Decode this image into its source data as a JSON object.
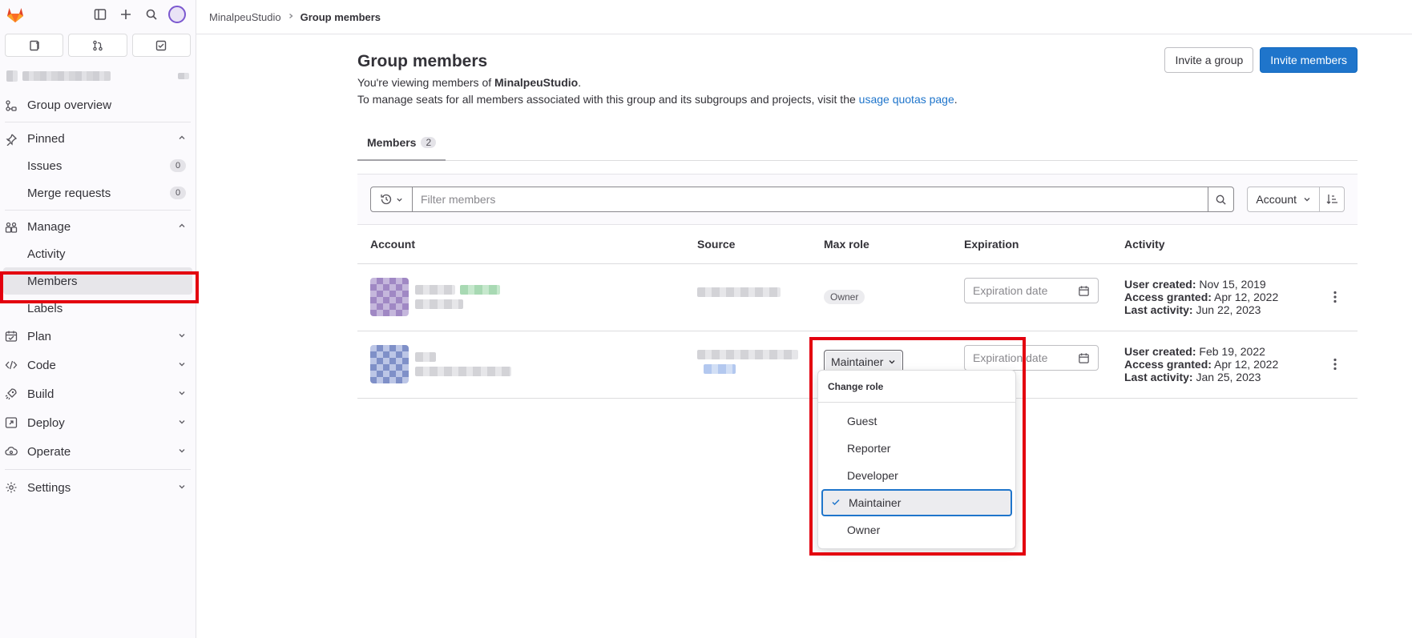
{
  "breadcrumb": {
    "group": "MinalpeuStudio",
    "current": "Group members"
  },
  "sidebar": {
    "group_overview": "Group overview",
    "pinned": "Pinned",
    "issues": "Issues",
    "issues_count": "0",
    "merge_requests": "Merge requests",
    "merge_requests_count": "0",
    "manage": "Manage",
    "activity": "Activity",
    "members": "Members",
    "labels": "Labels",
    "plan": "Plan",
    "code": "Code",
    "build": "Build",
    "deploy": "Deploy",
    "operate": "Operate",
    "settings": "Settings"
  },
  "header": {
    "title": "Group members",
    "invite_group": "Invite a group",
    "invite_members": "Invite members",
    "desc1_prefix": "You're viewing members of ",
    "desc1_group": "MinalpeuStudio",
    "desc1_suffix": ".",
    "desc2_prefix": "To manage seats for all members associated with this group and its subgroups and projects, visit the ",
    "desc2_link": "usage quotas page",
    "desc2_suffix": "."
  },
  "tabs": [
    {
      "label": "Members",
      "count": "2"
    }
  ],
  "filter": {
    "placeholder": "Filter members",
    "sort_label": "Account"
  },
  "table": {
    "columns": [
      "Account",
      "Source",
      "Max role",
      "Expiration",
      "Activity"
    ],
    "rows": [
      {
        "role": "Owner",
        "expiration_placeholder": "Expiration date",
        "user_created_label": "User created:",
        "user_created": " Nov 15, 2019",
        "access_granted_label": "Access granted:",
        "access_granted": " Apr 12, 2022",
        "last_activity_label": "Last activity:",
        "last_activity": " Jun 22, 2023"
      },
      {
        "role": "Maintainer",
        "expiration_placeholder": "Expiration date",
        "user_created_label": "User created:",
        "user_created": " Feb 19, 2022",
        "access_granted_label": "Access granted:",
        "access_granted": " Apr 12, 2022",
        "last_activity_label": "Last activity:",
        "last_activity": " Jan 25, 2023"
      }
    ]
  },
  "dropdown": {
    "header": "Change role",
    "items": [
      "Guest",
      "Reporter",
      "Developer",
      "Maintainer",
      "Owner"
    ],
    "selected": "Maintainer"
  },
  "colors": {
    "primary": "#1f75cb",
    "highlight": "#e3000f"
  }
}
